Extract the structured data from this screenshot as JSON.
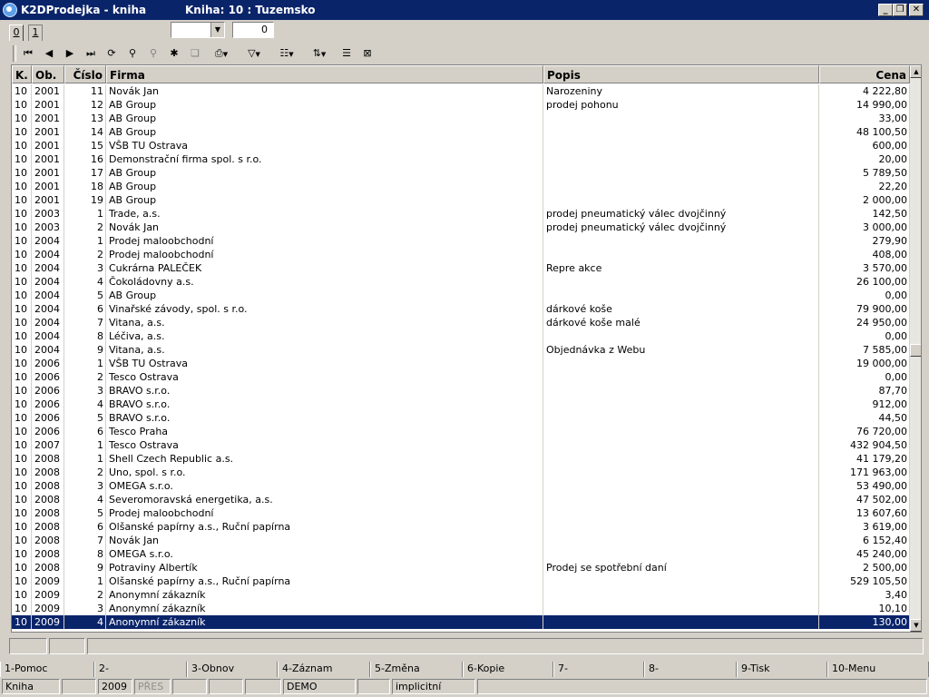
{
  "window": {
    "title": "K2DProdejka - kniha",
    "subtitle": "Kniha: 10 : Tuzemsko"
  },
  "tabs": [
    "0",
    "1"
  ],
  "combo": {
    "value": ""
  },
  "spin": {
    "value": "0"
  },
  "toolbar": {
    "icons": [
      "first-record-icon",
      "prev-record-icon",
      "next-record-icon",
      "last-record-icon",
      "refresh-icon",
      "find-icon",
      "find-next-icon",
      "new-record-icon",
      "copy-record-icon",
      "print-icon",
      "filter-icon",
      "columns-icon",
      "sort-icon",
      "tree-view-icon",
      "export-excel-icon"
    ]
  },
  "grid": {
    "columns": [
      "K.",
      "Ob.",
      "Číslo",
      "Firma",
      "Popis",
      "Cena"
    ],
    "rows": [
      [
        "10",
        "2001",
        "11",
        "Novák Jan",
        "Narozeniny",
        "4 222,80"
      ],
      [
        "10",
        "2001",
        "12",
        "AB Group",
        "prodej pohonu",
        "14 990,00"
      ],
      [
        "10",
        "2001",
        "13",
        "AB Group",
        "",
        "33,00"
      ],
      [
        "10",
        "2001",
        "14",
        "AB Group",
        "",
        "48 100,50"
      ],
      [
        "10",
        "2001",
        "15",
        "VŠB TU Ostrava",
        "",
        "600,00"
      ],
      [
        "10",
        "2001",
        "16",
        "Demonstrační firma spol. s r.o.",
        "",
        "20,00"
      ],
      [
        "10",
        "2001",
        "17",
        "AB Group",
        "",
        "5 789,50"
      ],
      [
        "10",
        "2001",
        "18",
        "AB Group",
        "",
        "22,20"
      ],
      [
        "10",
        "2001",
        "19",
        "AB Group",
        "",
        "2 000,00"
      ],
      [
        "10",
        "2003",
        "1",
        "Trade, a.s.",
        "prodej pneumatický válec dvojčinný",
        "142,50"
      ],
      [
        "10",
        "2003",
        "2",
        "Novák Jan",
        "prodej pneumatický válec dvojčinný",
        "3 000,00"
      ],
      [
        "10",
        "2004",
        "1",
        "Prodej maloobchodní",
        "",
        "279,90"
      ],
      [
        "10",
        "2004",
        "2",
        "Prodej maloobchodní",
        "",
        "408,00"
      ],
      [
        "10",
        "2004",
        "3",
        "Cukrárna PALEČEK",
        "Repre akce",
        "3 570,00"
      ],
      [
        "10",
        "2004",
        "4",
        "Čokoládovny a.s.",
        "",
        "26 100,00"
      ],
      [
        "10",
        "2004",
        "5",
        "AB Group",
        "",
        "0,00"
      ],
      [
        "10",
        "2004",
        "6",
        "Vinařské závody, spol. s r.o.",
        "dárkové koše",
        "79 900,00"
      ],
      [
        "10",
        "2004",
        "7",
        "Vitana, a.s.",
        "dárkové koše malé",
        "24 950,00"
      ],
      [
        "10",
        "2004",
        "8",
        "Léčiva, a.s.",
        "",
        "0,00"
      ],
      [
        "10",
        "2004",
        "9",
        "Vitana, a.s.",
        "Objednávka z Webu",
        "7 585,00"
      ],
      [
        "10",
        "2006",
        "1",
        "VŠB TU Ostrava",
        "",
        "19 000,00"
      ],
      [
        "10",
        "2006",
        "2",
        "Tesco Ostrava",
        "",
        "0,00"
      ],
      [
        "10",
        "2006",
        "3",
        "BRAVO s.r.o.",
        "",
        "87,70"
      ],
      [
        "10",
        "2006",
        "4",
        "BRAVO s.r.o.",
        "",
        "912,00"
      ],
      [
        "10",
        "2006",
        "5",
        "BRAVO s.r.o.",
        "",
        "44,50"
      ],
      [
        "10",
        "2006",
        "6",
        "Tesco Praha",
        "",
        "76 720,00"
      ],
      [
        "10",
        "2007",
        "1",
        "Tesco Ostrava",
        "",
        "432 904,50"
      ],
      [
        "10",
        "2008",
        "1",
        "Shell Czech Republic a.s.",
        "",
        "41 179,20"
      ],
      [
        "10",
        "2008",
        "2",
        "Uno, spol. s r.o.",
        "",
        "171 963,00"
      ],
      [
        "10",
        "2008",
        "3",
        "OMEGA s.r.o.",
        "",
        "53 490,00"
      ],
      [
        "10",
        "2008",
        "4",
        "Severomoravská energetika, a.s.",
        "",
        "47 502,00"
      ],
      [
        "10",
        "2008",
        "5",
        "Prodej maloobchodní",
        "",
        "13 607,60"
      ],
      [
        "10",
        "2008",
        "6",
        "Olšanské papírny a.s., Ruční papírna",
        "",
        "3 619,00"
      ],
      [
        "10",
        "2008",
        "7",
        "Novák Jan",
        "",
        "6 152,40"
      ],
      [
        "10",
        "2008",
        "8",
        "OMEGA s.r.o.",
        "",
        "45 240,00"
      ],
      [
        "10",
        "2008",
        "9",
        "Potraviny Albertík",
        "Prodej se spotřební daní",
        "2 500,00"
      ],
      [
        "10",
        "2009",
        "1",
        "Olšanské papírny a.s., Ruční papírna",
        "",
        "529 105,50"
      ],
      [
        "10",
        "2009",
        "2",
        "Anonymní zákazník",
        "",
        "3,40"
      ],
      [
        "10",
        "2009",
        "3",
        "Anonymní zákazník",
        "",
        "10,10"
      ],
      [
        "10",
        "2009",
        "4",
        "Anonymní zákazník",
        "",
        "130,00"
      ]
    ],
    "selected_index": 39
  },
  "fkeys": [
    "1-Pomoc",
    "2-",
    "3-Obnov",
    "4-Záznam",
    "5-Změna",
    "6-Kopie",
    "7-",
    "8-",
    "9-Tisk",
    "10-Menu"
  ],
  "status": {
    "mode": "Kniha",
    "year": "2009",
    "pres": "PŘES",
    "db": "DEMO",
    "profile": "implicitní"
  }
}
